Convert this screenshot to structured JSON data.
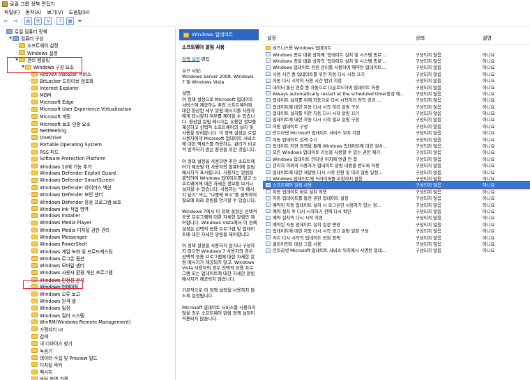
{
  "window": {
    "title": "로컬 그룹 정책 편집기"
  },
  "menu": [
    "파일(F)",
    "동작(A)",
    "보기(V)",
    "도움말(H)"
  ],
  "tree": [
    {
      "label": "로컬 컴퓨터 정책",
      "level": 0,
      "exp": "",
      "icon": "pc"
    },
    {
      "label": "컴퓨터 구성",
      "level": 1,
      "exp": "▼",
      "icon": "pc"
    },
    {
      "label": "소프트웨어 설정",
      "level": 2,
      "exp": "›",
      "icon": "folder"
    },
    {
      "label": "Windows 설정",
      "level": 2,
      "exp": "›",
      "icon": "folder"
    },
    {
      "label": "관리 템플릿",
      "level": 2,
      "exp": "▼",
      "icon": "folder"
    },
    {
      "label": "Windows 구성 요소",
      "level": 3,
      "exp": "▼",
      "icon": "folder"
    },
    {
      "label": "ActiveX Installer 서비스",
      "level": 4,
      "exp": "",
      "icon": "folder"
    },
    {
      "label": "BitLocker 드라이브 암호화",
      "level": 4,
      "exp": "›",
      "icon": "folder"
    },
    {
      "label": "Internet Explorer",
      "level": 4,
      "exp": "›",
      "icon": "folder"
    },
    {
      "label": "MDM",
      "level": 4,
      "exp": "",
      "icon": "folder"
    },
    {
      "label": "Microsoft Edge",
      "level": 4,
      "exp": "",
      "icon": "folder"
    },
    {
      "label": "Microsoft User Experience Virtualization",
      "level": 4,
      "exp": "›",
      "icon": "folder"
    },
    {
      "label": "Microsoft 계정",
      "level": 4,
      "exp": "",
      "icon": "folder"
    },
    {
      "label": "Microsoft 보조 인증 요소",
      "level": 4,
      "exp": "",
      "icon": "folder"
    },
    {
      "label": "NetMeeting",
      "level": 4,
      "exp": "",
      "icon": "folder"
    },
    {
      "label": "OneDrive",
      "level": 4,
      "exp": "",
      "icon": "folder"
    },
    {
      "label": "Portable Operating System",
      "level": 4,
      "exp": "",
      "icon": "folder"
    },
    {
      "label": "RSS 피드",
      "level": 4,
      "exp": "",
      "icon": "folder"
    },
    {
      "label": "Software Protection Platform",
      "level": 4,
      "exp": "",
      "icon": "folder"
    },
    {
      "label": "Windows 10에 기능 추가",
      "level": 4,
      "exp": "",
      "icon": "folder"
    },
    {
      "label": "Windows Defender Exploit Guard",
      "level": 4,
      "exp": "›",
      "icon": "folder"
    },
    {
      "label": "Windows Defender SmartScreen",
      "level": 4,
      "exp": "›",
      "icon": "folder"
    },
    {
      "label": "Windows Defender 바이러스 백신",
      "level": 4,
      "exp": "›",
      "icon": "folder"
    },
    {
      "label": "Windows Defender 보안 센터",
      "level": 4,
      "exp": "›",
      "icon": "folder"
    },
    {
      "label": "Windows Defender 응용 프로그램 보호",
      "level": 4,
      "exp": "",
      "icon": "folder"
    },
    {
      "label": "Windows Ink 작업 영역",
      "level": 4,
      "exp": "",
      "icon": "folder"
    },
    {
      "label": "Windows Installer",
      "level": 4,
      "exp": "",
      "icon": "folder"
    },
    {
      "label": "Windows Media Player",
      "level": 4,
      "exp": "›",
      "icon": "folder"
    },
    {
      "label": "Windows Media 디지털 권한 관리",
      "level": 4,
      "exp": "",
      "icon": "folder"
    },
    {
      "label": "Windows Messenger",
      "level": 4,
      "exp": "",
      "icon": "folder"
    },
    {
      "label": "Windows PowerShell",
      "level": 4,
      "exp": "",
      "icon": "folder"
    },
    {
      "label": "Windows 게임 녹화 및 브로드캐스팅",
      "level": 4,
      "exp": "",
      "icon": "folder"
    },
    {
      "label": "Windows 로그온 옵션",
      "level": 4,
      "exp": "",
      "icon": "folder"
    },
    {
      "label": "Windows 모바일 센터",
      "level": 4,
      "exp": "",
      "icon": "folder"
    },
    {
      "label": "Windows 사용자 환경 개선 프로그램",
      "level": 4,
      "exp": "",
      "icon": "folder"
    },
    {
      "label": "Windows 안정성 분석",
      "level": 4,
      "exp": "",
      "icon": "folder"
    },
    {
      "label": "Windows 업데이트",
      "level": 4,
      "exp": "›",
      "icon": "folder",
      "selected": true
    },
    {
      "label": "Windows 오류 보고",
      "level": 4,
      "exp": "›",
      "icon": "folder"
    },
    {
      "label": "Windows 원격 셸",
      "level": 4,
      "exp": "",
      "icon": "folder"
    },
    {
      "label": "Windows 일정",
      "level": 4,
      "exp": "",
      "icon": "folder"
    },
    {
      "label": "Windows 컬러 시스템",
      "level": 4,
      "exp": "",
      "icon": "folder"
    },
    {
      "label": "WinRM(Windows Remote Management)",
      "level": 4,
      "exp": "›",
      "icon": "folder"
    },
    {
      "label": "가젯자리 UI",
      "level": 4,
      "exp": "",
      "icon": "folder"
    },
    {
      "label": "검색",
      "level": 4,
      "exp": "",
      "icon": "folder"
    },
    {
      "label": "내 디바이스 찾기",
      "level": 4,
      "exp": "",
      "icon": "folder"
    },
    {
      "label": "녹음기",
      "level": 4,
      "exp": "",
      "icon": "folder"
    },
    {
      "label": "데이터 수집 및 Preview 빌드",
      "level": 4,
      "exp": "",
      "icon": "folder"
    },
    {
      "label": "디지털 락커",
      "level": 4,
      "exp": "",
      "icon": "folder"
    },
    {
      "label": "메시지",
      "level": 4,
      "exp": "",
      "icon": "folder"
    },
    {
      "label": "바탕 화면 가젯",
      "level": 4,
      "exp": "",
      "icon": "folder"
    }
  ],
  "desc": {
    "header": "Windows 업데이트",
    "policy_title": "소프트웨어 알림 사용",
    "edit_prefix": "정책 설정",
    "edit_suffix": " 편집",
    "requirements": "요구 사항:\nWindows Server 2008, Windows 7 및 Windows Vista",
    "p1": "설명:\n이 정책 설정으로 Microsoft 업데이트 서비스에 제공하는 추천 소프트웨어에 대한 향상된 세부 알림 메시지를 사용자에게 표시할지 여부를 제어할 수 있습니다. 향상된 알림 메시지는 유용한 정보를 제공하고 선택적 소프트웨어의 설치 및 사용을 장려합니다. 이 정책 설정은 로컬 사용자에게 Microsoft 업데이트 서비스에 대한 액세스를 허용하는, 관리가 비교적 엄격하지 않은 환경을 위한 것입니다.",
    "p2": "이 정책 설정을 사용하면 추천 소프트웨어가 제공될 때 사용자의 컴퓨터에 알림 메시지가 표시됩니다. 사용자는 알림을 클릭하여 Windows 업데이트를 열고 소프트웨어에 대한 자세한 정보를 보거나 설치할 수 있습니다. 사용자는 \"이 메시지 닫기\" 또는 \"나중에 표시\"를 클릭하여 필요에 따라 알림을 연기할 수 있습니다.",
    "p3": "Windows 7에서 이 정책 설정은 선택적 응용 프로그램에 대한 자세한 알림만 제어합니다. Windows Vista에서 이 정책 설정은 선택적 응용 프로그램 및 업데이트에 대한 자세한 알림을 제어합니다.",
    "p4": "이 정책 설정을 사용하지 않거나 구성하지 않으면 Windows 7 사용자의 경우 선택적 응용 프로그램에 대한 자세한 알림 메시지가 제공되지 않고, Windows Vista 사용자의 경우 선택적 응용 프로그램 또는 업데이트에 대한 자세한 알림 메시지가 제공되지 않습니다.",
    "p5": "기본적으로 이 정책 설정을 사용하지 않도록 설정됩니다.",
    "p6": "Microsoft 업데이트 서비스를 사용하지 않을 경우 소프트웨어 알림 정책 설정이 적용되지 않습니다."
  },
  "list": {
    "headers": {
      "setting": "설정",
      "state": "상태",
      "comment": "설명"
    },
    "rows": [
      {
        "name": "비즈니스용 Windows 업데이트",
        "state": "",
        "comment": "",
        "folder": true
      },
      {
        "name": "Windows 종료 대화 상자에 '업데이트 설치 및 시스템 종료'...",
        "state": "구성되지 않음",
        "comment": "아니요"
      },
      {
        "name": "Windows 종료 대화 상자의 '업데이트 설치 및 시스템 종료'...",
        "state": "구성되지 않음",
        "comment": "아니요"
      },
      {
        "name": "Windows 업데이트 전원 관리를 사용하여 예약된 업데이트...",
        "state": "구성되지 않음",
        "comment": "아니요"
      },
      {
        "name": "사용 시간 중 업데이트를 위한 자동 다시 시작 끄기",
        "state": "구성되지 않음",
        "comment": "아니요"
      },
      {
        "name": "자동 다시 시작의 사용 시간 범위 지정",
        "state": "구성되지 않음",
        "comment": "아니요"
      },
      {
        "name": "데이터 통신 연결 중 자동으로 다운로드하여 업데이트 허용",
        "state": "구성되지 않음",
        "comment": "아니요"
      },
      {
        "name": "Always automatically restart at the scheduled time(항상 예...",
        "state": "구성되지 않음",
        "comment": "아니요"
      },
      {
        "name": "업데이트 설치를 위해 자동으로 다시 시작하기 전의 경과 ...",
        "state": "구성되지 않음",
        "comment": "아니요"
      },
      {
        "name": "업데이트에 대한 자동 다시 시작 미리 알림 구성",
        "state": "구성되지 않음",
        "comment": "아니요"
      },
      {
        "name": "업데이트 설치를 위한 자동 다시 시작 알림 끄기",
        "state": "구성되지 않음",
        "comment": "아니요"
      },
      {
        "name": "업데이트에 대한 자동 다시 시작 필요 알림 구성",
        "state": "구성되지 않음",
        "comment": "아니요"
      },
      {
        "name": "자동 업데이트 구성",
        "state": "구성되지 않음",
        "comment": "아니요"
      },
      {
        "name": "인트라넷 Microsoft 업데이트 서비스 위치 지정",
        "state": "구성되지 않음",
        "comment": "아니요"
      },
      {
        "name": "자동 업데이트 검색 주기",
        "state": "구성되지 않음",
        "comment": "아니요"
      },
      {
        "name": "업데이트 지연 정책을 통해 Windows 업데이트에 대한 검사...",
        "state": "구성되지 않음",
        "comment": "아니요"
      },
      {
        "name": "모든 Windows 업데이트 기능을 사용할 수 있는 권한 제거",
        "state": "구성되지 않음",
        "comment": "아니요"
      },
      {
        "name": "Windows 업데이트 인터넷 위치에 연결 안 함",
        "state": "구성되지 않음",
        "comment": "아니요"
      },
      {
        "name": "관리자 이외의 사용자가 업데이트 알림 내용을 받도록 허용",
        "state": "구성되지 않음",
        "comment": "아니요"
      },
      {
        "name": "업데이트에 대한 재알림 다시 시작 전환 및 미리 알림 일정...",
        "state": "구성되지 않음",
        "comment": "아니요"
      },
      {
        "name": "Windows 업데이트에 드라이버를 포함하지 않음",
        "state": "구성되지 않음",
        "comment": "아니요"
      },
      {
        "name": "소프트웨어 알림 사용",
        "state": "구성되지 않음",
        "comment": "아니요",
        "selected": true
      },
      {
        "name": "자동 업데이트 바로 설치 허용",
        "state": "구성되지 않음",
        "comment": "아니요"
      },
      {
        "name": "자동 업데이트를 통한 권장 업데이트 설정",
        "state": "구성되지 않음",
        "comment": "아니요"
      },
      {
        "name": "예약된 자동 업데이트 설치 시 로그온한 사용자가 있는 경...",
        "state": "구성되지 않음",
        "comment": "아니요"
      },
      {
        "name": "예약 설치 후 다시 시작하기 전에 다시 확인",
        "state": "구성되지 않음",
        "comment": "아니요"
      },
      {
        "name": "예약 설치의 다시 시작 지연",
        "state": "구성되지 않음",
        "comment": "아니요"
      },
      {
        "name": "예약된 자동 업데이트 설치 일정 변경",
        "state": "구성되지 않음",
        "comment": "아니요"
      },
      {
        "name": "업데이트에 대한 자동 다시 시작 경고 알림 일정 구성",
        "state": "구성되지 않음",
        "comment": "아니요"
      },
      {
        "name": "카트 다시 시작의 업데이트 전원 정책",
        "state": "구성되지 않음",
        "comment": "아니요"
      },
      {
        "name": "클라이언트 대상 그룹 사용",
        "state": "구성되지 않음",
        "comment": "아니요"
      },
      {
        "name": "인트라넷 Microsoft 업데이트 서비스 위치에서 서명된 업데...",
        "state": "구성되지 않음",
        "comment": "아니요"
      }
    ]
  }
}
